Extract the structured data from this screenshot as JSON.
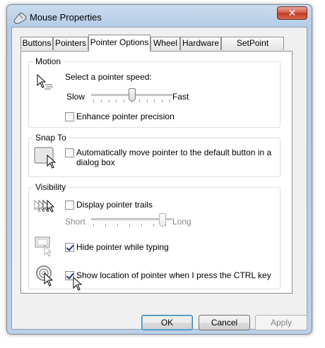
{
  "window": {
    "title": "Mouse Properties",
    "close_label": "✕"
  },
  "tabs": [
    {
      "label": "Buttons",
      "active": false
    },
    {
      "label": "Pointers",
      "active": false
    },
    {
      "label": "Pointer Options",
      "active": true
    },
    {
      "label": "Wheel",
      "active": false
    },
    {
      "label": "Hardware",
      "active": false
    },
    {
      "label": "SetPoint Settings",
      "active": false
    }
  ],
  "motion": {
    "title": "Motion",
    "speed_label": "Select a pointer speed:",
    "slow_label": "Slow",
    "fast_label": "Fast",
    "speed_value_fraction": 0.5,
    "precision_label": "Enhance pointer precision",
    "precision_checked": false
  },
  "snap_to": {
    "title": "Snap To",
    "auto_move_label_line1": "Automatically move pointer to the default button in a",
    "auto_move_label_line2": "dialog box",
    "auto_move_checked": false
  },
  "visibility": {
    "title": "Visibility",
    "trails_label": "Display pointer trails",
    "trails_checked": false,
    "short_label": "Short",
    "long_label": "Long",
    "trail_length_fraction": 1.0,
    "hide_label": "Hide pointer while typing",
    "hide_checked": true,
    "ctrl_label": "Show location of pointer when I press the CTRL key",
    "ctrl_checked": true
  },
  "buttons": {
    "ok": "OK",
    "cancel": "Cancel",
    "apply": "Apply"
  }
}
